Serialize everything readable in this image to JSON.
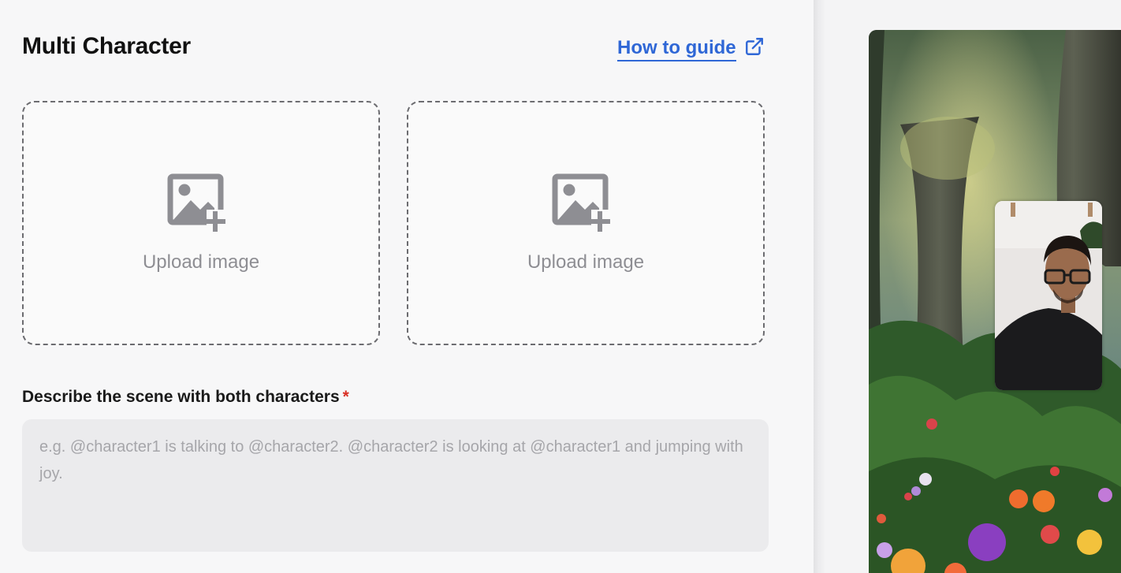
{
  "header": {
    "title": "Multi Character",
    "guide_link": "How to guide",
    "guide_icon": "external-link-icon"
  },
  "uploads": [
    {
      "label": "Upload image",
      "icon": "image-add-icon"
    },
    {
      "label": "Upload image",
      "icon": "image-add-icon"
    }
  ],
  "scene": {
    "label": "Describe the scene with both characters",
    "required_mark": "*",
    "value": "",
    "placeholder": "e.g. @character1 is talking to @character2. @character2 is looking at @character1 and jumping with joy."
  },
  "colors": {
    "link": "#2f67d6",
    "required": "#d93025",
    "upload_border": "#6c6c70",
    "icon_gray": "#8e8e93"
  }
}
